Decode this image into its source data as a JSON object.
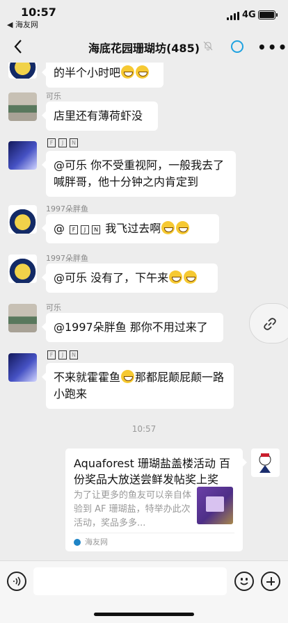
{
  "status": {
    "time": "10:57",
    "back_app": "◀ 海友网",
    "network": "4G"
  },
  "chat": {
    "title": "海底花园珊瑚坊(485)"
  },
  "messages": [
    {
      "sender": "",
      "text": "的半个小时吧"
    },
    {
      "sender": "可乐",
      "text": "店里还有薄荷虾没"
    },
    {
      "sender": "",
      "text": "@可乐  你不受重视阿，一般我去了喊胖哥，他十分钟之内肯定到"
    },
    {
      "sender": "1997朵胖鱼",
      "text": "@ ",
      "text_after": "我飞过去啊"
    },
    {
      "sender": "1997朵胖鱼",
      "text": "@可乐  没有了，下午来"
    },
    {
      "sender": "可乐",
      "text": "@1997朵胖鱼 那你不用过来了"
    },
    {
      "sender": "",
      "text": "不来就霍霍鱼",
      "text_after": "那都屁颠屁颠一路小跑来"
    }
  ],
  "timestamp": "10:57",
  "card": {
    "title": "Aquaforest 珊瑚盐盖楼活动 百份奖品大放送尝鲜发帖奖上奖",
    "description": "为了让更多的鱼友可以亲自体验到 AF 珊瑚盐，特举办此次活动，奖品多多...",
    "source": "海友网"
  },
  "colors": {
    "background": "#ededed",
    "accent": "#1fa2e0",
    "bubble": "#ffffff"
  },
  "icons": [
    "back-arrow-icon",
    "mute-icon",
    "more-icon",
    "link-icon",
    "voice-icon",
    "emoji-icon",
    "plus-icon"
  ]
}
